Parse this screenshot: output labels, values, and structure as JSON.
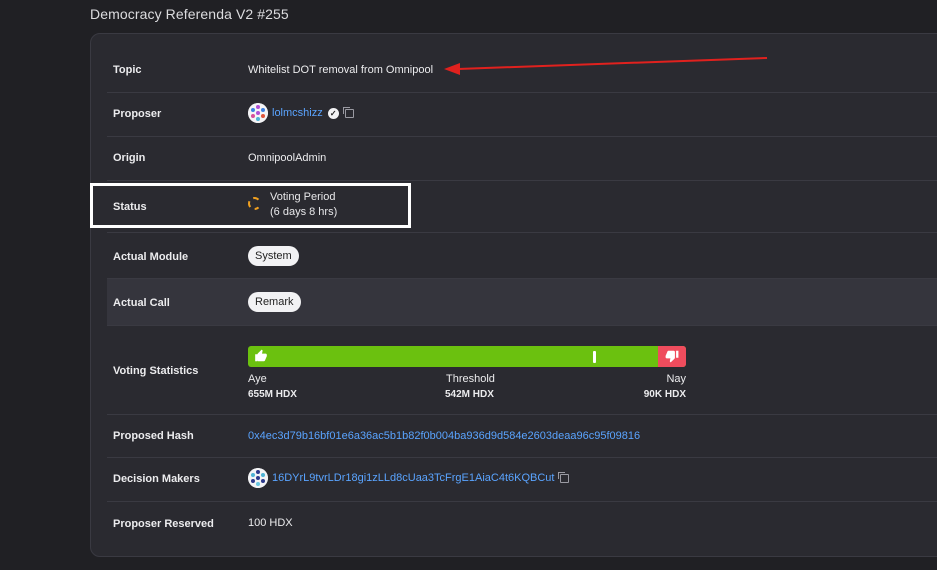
{
  "page": {
    "title": "Democracy Referenda V2 #255"
  },
  "rows": {
    "topic": {
      "label": "Topic",
      "value": "Whitelist DOT removal from Omnipool"
    },
    "proposer": {
      "label": "Proposer",
      "value": "lolmcshizz"
    },
    "origin": {
      "label": "Origin",
      "value": "OmnipoolAdmin"
    },
    "status": {
      "label": "Status",
      "line1": "Voting Period",
      "line2": "(6 days 8 hrs)"
    },
    "actual_module": {
      "label": "Actual Module",
      "value": "System"
    },
    "actual_call": {
      "label": "Actual Call",
      "value": "Remark"
    },
    "voting_statistics": {
      "label": "Voting Statistics",
      "aye_label": "Aye",
      "aye_amount": "655M HDX",
      "threshold_label": "Threshold",
      "threshold_amount": "542M HDX",
      "nay_label": "Nay",
      "nay_amount": "90K HDX",
      "threshold_fraction": 0.787,
      "nay_fraction": 0.065
    },
    "proposed_hash": {
      "label": "Proposed Hash",
      "value": "0x4ec3d79b16bf01e6a36ac5b1b82f0b004ba936d9d584e2603deaa96c95f09816"
    },
    "decision_makers": {
      "label": "Decision Makers",
      "value": "16DYrL9tvrLDr18gi1zLLd8cUaa3TcFrgE1AiaC4t6KQBCut"
    },
    "proposer_reserved": {
      "label": "Proposer Reserved",
      "value": "100 HDX"
    }
  },
  "colors": {
    "aye": "#6bc10f",
    "nay": "#ef4c5d",
    "link": "#5aa4ff",
    "pending": "#f0a020",
    "annotation_arrow": "#e0211e"
  },
  "icons": {
    "proposer_avatar": "identicon",
    "verified": "verified-badge-icon",
    "copy": "copy-icon",
    "status": "spinner-icon",
    "aye": "thumbs-up-icon",
    "nay": "thumbs-down-icon"
  }
}
